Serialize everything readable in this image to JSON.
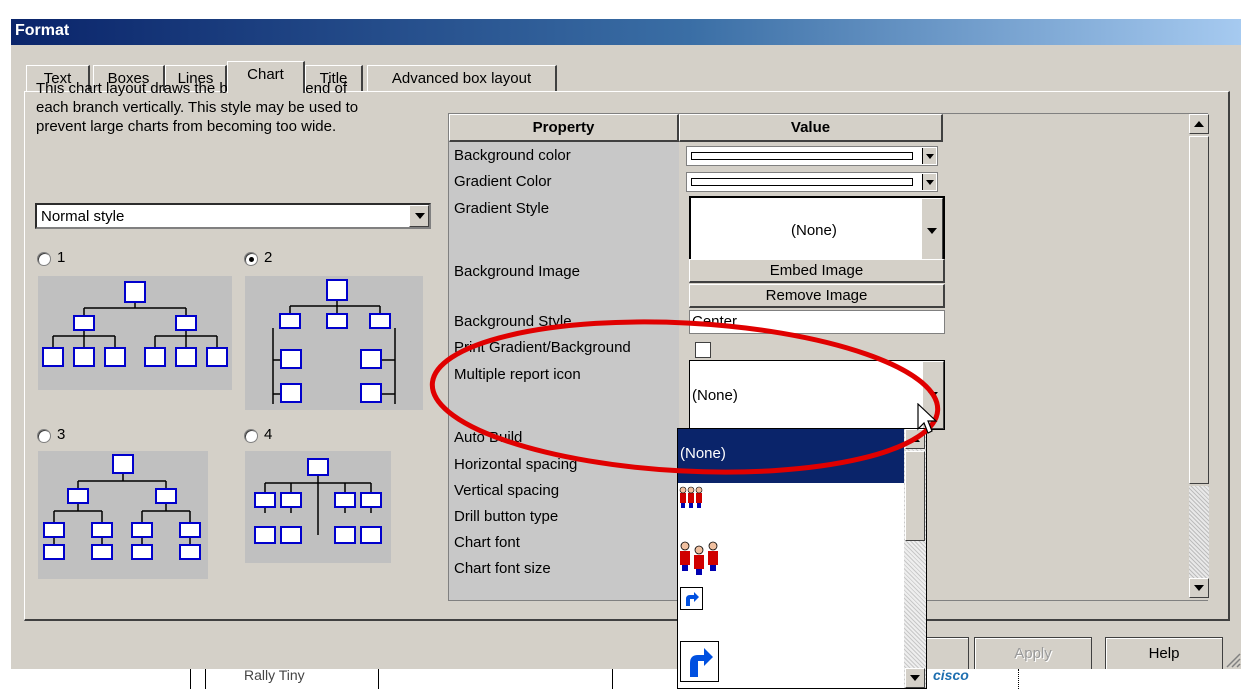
{
  "window": {
    "title": "Format"
  },
  "tabs": [
    {
      "label": "Text",
      "active": false
    },
    {
      "label": "Boxes",
      "active": false
    },
    {
      "label": "Lines",
      "active": false
    },
    {
      "label": "Chart",
      "active": true
    },
    {
      "label": "Title",
      "active": false
    },
    {
      "label": "Advanced box layout",
      "active": false
    }
  ],
  "chart_tab": {
    "description_lines": [
      "This chart layout draws the boxes at the end of",
      "each branch vertically. This style may be used to",
      "prevent large charts from becoming too wide."
    ],
    "style_select": {
      "value": "Normal style"
    },
    "layout_options": [
      {
        "label": "1",
        "selected": false
      },
      {
        "label": "2",
        "selected": true
      },
      {
        "label": "3",
        "selected": false
      },
      {
        "label": "4",
        "selected": false
      }
    ]
  },
  "property_grid": {
    "headers": {
      "property": "Property",
      "value": "Value"
    },
    "rows": [
      {
        "property": "Background color"
      },
      {
        "property": "Gradient Color"
      },
      {
        "property": "Gradient Style",
        "value": "(None)"
      },
      {
        "property": "Background Image",
        "buttons": [
          "Embed Image",
          "Remove Image"
        ]
      },
      {
        "property": "Background Style",
        "value": "Center"
      },
      {
        "property": "Print Gradient/Background",
        "checked": false
      },
      {
        "property": "Multiple report icon",
        "value": "(None)"
      },
      {
        "property": "Auto Build"
      },
      {
        "property": "Horizontal spacing"
      },
      {
        "property": "Vertical spacing"
      },
      {
        "property": "Drill button type"
      },
      {
        "property": "Chart font"
      },
      {
        "property": "Chart font size"
      }
    ],
    "dropdown_options": [
      {
        "label": "(None)",
        "selected": true,
        "icon": ""
      },
      {
        "label": "",
        "icon": "people-small-icon"
      },
      {
        "label": "",
        "icon": "people-large-icon"
      },
      {
        "label": "",
        "icon": "arrow-small-icon"
      },
      {
        "label": "",
        "icon": "arrow-large-icon"
      }
    ]
  },
  "buttons": {
    "apply": "Apply",
    "help": "Help"
  },
  "background_app": {
    "text_left": "Rally Tiny",
    "text_right": "cisco"
  },
  "colors": {
    "titlebar": "#0a246a",
    "selection": "#0a246a",
    "annotation": "#e00000",
    "node_border": "#0000cc"
  }
}
